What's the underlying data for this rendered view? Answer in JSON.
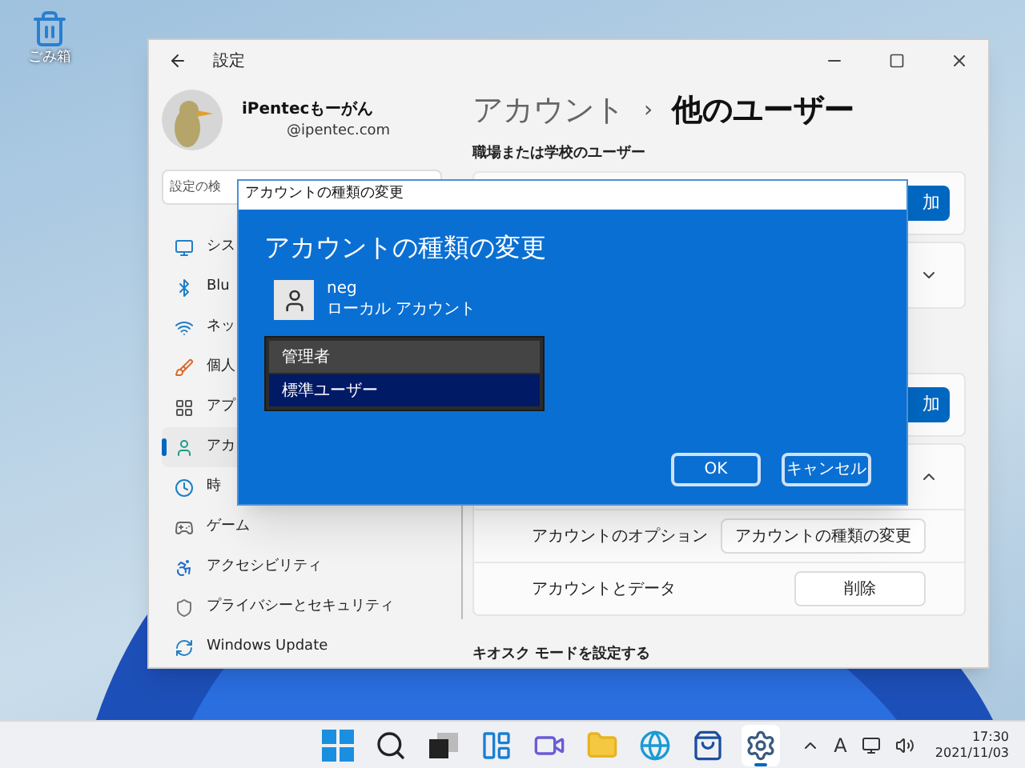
{
  "desktop": {
    "icon_label": "ごみ箱"
  },
  "settings": {
    "title": "設定",
    "profile": {
      "name": "iPentecもーがん",
      "email": "@ipentec.com"
    },
    "search": {
      "placeholder": "設定の検"
    },
    "sidebar": {
      "items": [
        {
          "label": "シス",
          "selected": false
        },
        {
          "label": "Blu",
          "selected": false
        },
        {
          "label": "ネッ",
          "selected": false
        },
        {
          "label": "個人",
          "selected": false
        },
        {
          "label": "アプ",
          "selected": false
        },
        {
          "label": "アカ",
          "selected": true
        },
        {
          "label": "時",
          "selected": false
        },
        {
          "label": "ゲーム",
          "selected": false
        },
        {
          "label": "アクセシビリティ",
          "selected": false
        },
        {
          "label": "プライバシーとセキュリティ",
          "selected": false
        },
        {
          "label": "Windows Update",
          "selected": false
        }
      ]
    },
    "main": {
      "breadcrumb": {
        "parent": "アカウント",
        "separator": "›",
        "current": "他のユーザー"
      },
      "section_label": "職場または学校のユーザー",
      "cards": [
        {
          "kind": "button",
          "button": "加"
        },
        {
          "kind": "expander",
          "expanded": false
        },
        {
          "kind": "button",
          "button": "加"
        },
        {
          "kind": "expander",
          "expanded": true,
          "rows": [
            {
              "label": "アカウントのオプション",
              "button": "アカウントの種類の変更"
            },
            {
              "label": "アカウントとデータ",
              "button": "削除"
            }
          ]
        }
      ],
      "footer_label": "キオスク モードを設定する"
    }
  },
  "dialog": {
    "title": "アカウントの種類の変更",
    "heading": "アカウントの種類の変更",
    "user": {
      "name": "neg",
      "type": "ローカル アカウント"
    },
    "options": [
      {
        "label": "管理者",
        "selected": false
      },
      {
        "label": "標準ユーザー",
        "selected": true
      }
    ],
    "buttons": [
      "OK",
      "キャンセル"
    ]
  },
  "taskbar": {
    "apps": [
      {
        "selected": false
      },
      {
        "selected": false
      },
      {
        "selected": false
      },
      {
        "selected": false
      },
      {
        "selected": false
      },
      {
        "selected": false
      },
      {
        "selected": false
      },
      {
        "selected": false
      },
      {
        "selected": true
      }
    ],
    "input_indicator": "A",
    "time": "17:30",
    "date": "2021/11/03"
  }
}
